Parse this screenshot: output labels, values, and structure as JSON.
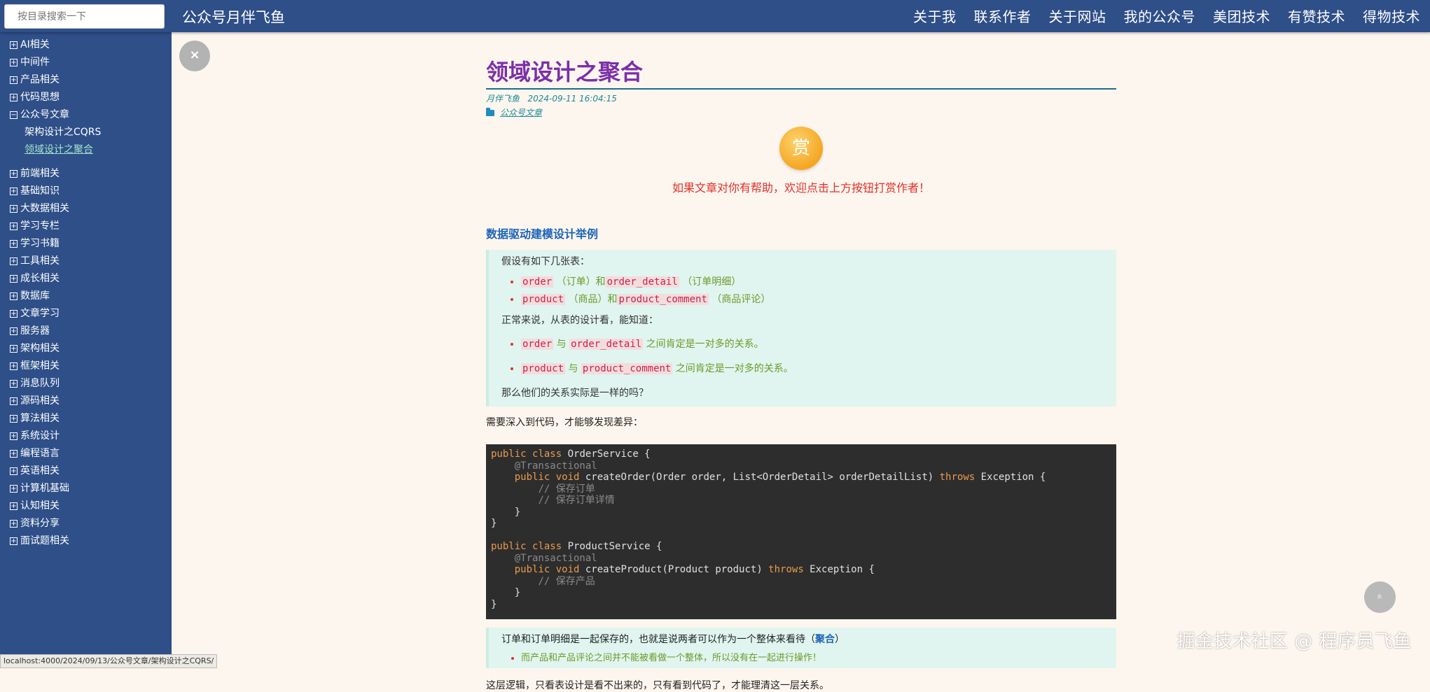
{
  "search": {
    "placeholder": "按目录搜索一下"
  },
  "site_title": "公众号月伴飞鱼",
  "nav": [
    "关于我",
    "联系作者",
    "关于网站",
    "我的公众号",
    "美团技术",
    "有赞技术",
    "得物技术"
  ],
  "sidebar": {
    "groups_before": [
      "AI相关",
      "中间件",
      "产品相关",
      "代码思想"
    ],
    "expanded": {
      "label": "公众号文章",
      "children": [
        "架构设计之CQRS",
        "领域设计之聚合"
      ],
      "active_index": 1
    },
    "groups_after": [
      "前端相关",
      "基础知识",
      "大数据相关",
      "学习专栏",
      "学习书籍",
      "工具相关",
      "成长相关",
      "数据库",
      "文章学习",
      "服务器",
      "架构相关",
      "框架相关",
      "消息队列",
      "源码相关",
      "算法相关",
      "系统设计",
      "编程语言",
      "英语相关",
      "计算机基础",
      "认知相关",
      "资料分享",
      "面试题相关"
    ],
    "toggle_plus": "+",
    "toggle_minus": "−"
  },
  "close_button": "×",
  "status_url": "localhost:4000/2024/09/13/公众号文章/架构设计之CQRS/",
  "post": {
    "title": "领域设计之聚合",
    "author": "月伴飞鱼",
    "date": "2024-09-11 16:04:15",
    "category": "公众号文章",
    "reward_label": "赏",
    "reward_tip": "如果文章对你有帮助，欢迎点击上方按钮打赏作者！",
    "section_heading": "数据驱动建模设计举例",
    "q1_intro": "假设有如下几张表：",
    "tables": [
      {
        "a": "order",
        "a_note": "（订单）和",
        "b": "order_detail",
        "b_note": "（订单明细）"
      },
      {
        "a": "product",
        "a_note": "（商品）和",
        "b": "product_comment",
        "b_note": "（商品评论）"
      }
    ],
    "q1_mid": "正常来说，从表的设计看，能知道：",
    "relations": [
      {
        "a": "order",
        "mid": "与",
        "b": "order_detail",
        "tail": "之间肯定是一对多的关系。"
      },
      {
        "a": "product",
        "mid": "与",
        "b": "product_comment",
        "tail": "之间肯定是一对多的关系。"
      }
    ],
    "q1_end": "那么他们的关系实际是一样的吗？",
    "code_intro": "需要深入到代码，才能够发现差异：",
    "q2_text": "订单和订单明细是一起保存的，也就是说两者可以作为一个整体来看待（",
    "q2_strong": "聚合",
    "q2_close": "）",
    "q2_item": "而产品和产品评论之间并不能被看做一个整体，所以没有在一起进行操作！",
    "cut_text": "这层逻辑，只看表设计是看不出来的，只有看到代码了，才能理清这一层关系。"
  },
  "code": {
    "kw_public": "public",
    "kw_class": "class",
    "kw_void": "void",
    "kw_throws": "throws",
    "annotation": "@Transactional",
    "os_name": " OrderService {",
    "os_sig": " createOrder(Order order, List<OrderDetail> orderDetailList) ",
    "exc": " Exception {",
    "c1": "// 保存订单",
    "c2": "// 保存订单详情",
    "ps_name": " ProductService {",
    "ps_sig": " createProduct(Product product) ",
    "c3": "// 保存产品",
    "close": "}"
  },
  "back_to_top": "»",
  "watermark": "掘金技术社区 @ 程序员飞鱼"
}
